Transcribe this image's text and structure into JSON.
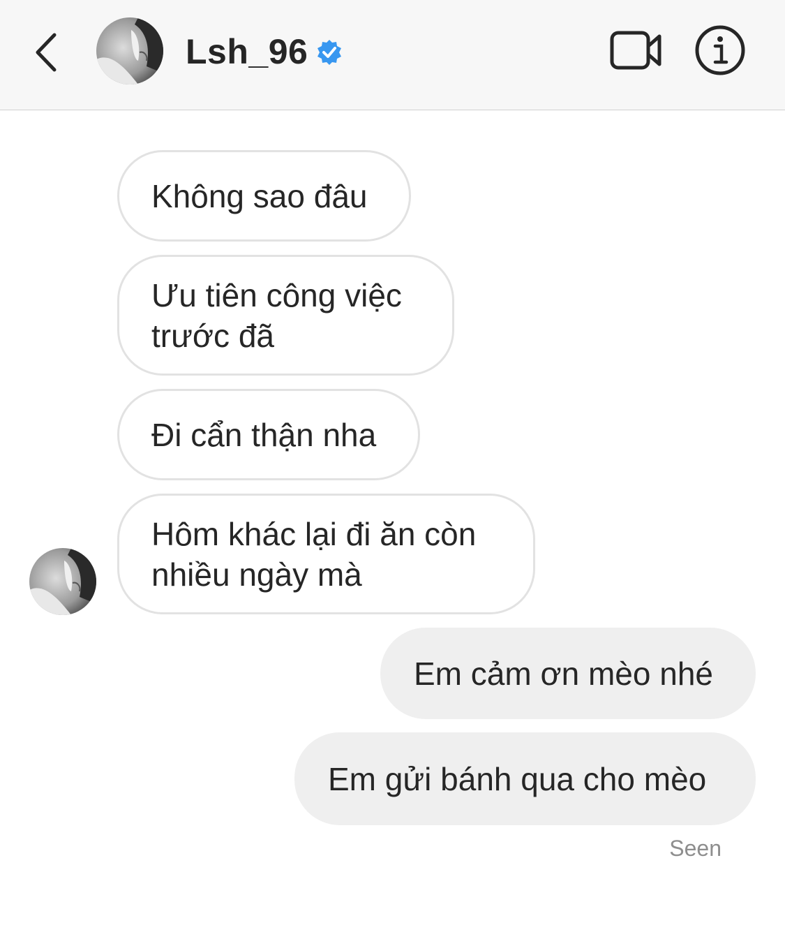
{
  "header": {
    "username": "Lsh_96",
    "verified_color": "#3897f0"
  },
  "messages": {
    "incoming": [
      "Không sao đâu",
      "Ưu tiên công việc",
      "trước đã",
      "Đi cẩn thận nha",
      "Hôm khác lại đi ăn còn",
      "nhiều ngày mà"
    ],
    "outgoing": [
      "Em cảm ơn mèo nhé",
      "Em gửi bánh qua cho mèo"
    ]
  },
  "status": {
    "seen": "Seen"
  },
  "icons": {
    "back": "chevron-left-icon",
    "verified": "verified-badge-icon",
    "video": "video-camera-icon",
    "info": "info-icon"
  }
}
